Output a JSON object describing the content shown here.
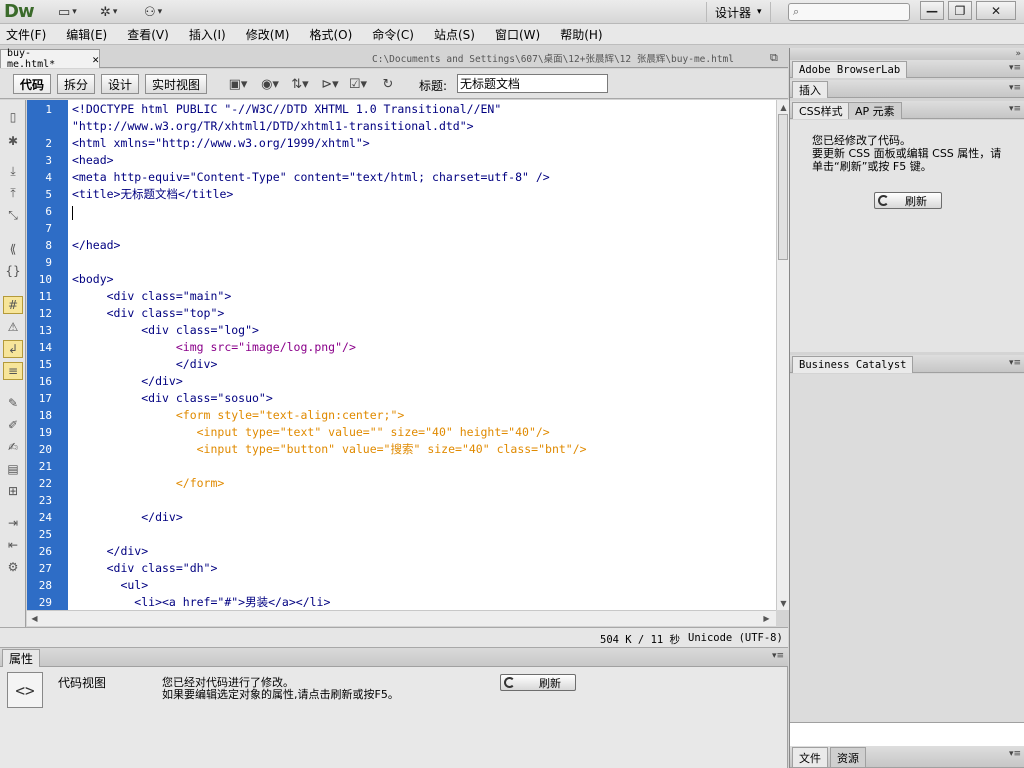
{
  "app": {
    "logo": "Dw",
    "workspace": "设计器",
    "icons": [
      "layout-icon",
      "gear-icon",
      "site-icon"
    ]
  },
  "menu": [
    "文件(F)",
    "编辑(E)",
    "查看(V)",
    "插入(I)",
    "修改(M)",
    "格式(O)",
    "命令(C)",
    "站点(S)",
    "窗口(W)",
    "帮助(H)"
  ],
  "document": {
    "tab_name": "buy-me.html*",
    "path": "C:\\Documents and Settings\\607\\桌面\\12+张晨辉\\12 张晨辉\\buy-me.html"
  },
  "doc_toolbar": {
    "code": "代码",
    "split": "拆分",
    "design": "设计",
    "live": "实时视图",
    "title_label": "标题:",
    "title_value": "无标题文档"
  },
  "line_numbers": [
    "1",
    "",
    "2",
    "3",
    "4",
    "5",
    "6",
    "7",
    "8",
    "9",
    "10",
    "11",
    "12",
    "13",
    "14",
    "15",
    "16",
    "17",
    "18",
    "19",
    "20",
    "21",
    "22",
    "23",
    "24",
    "25",
    "26",
    "27",
    "28",
    "29"
  ],
  "code": [
    {
      "t": "<!DOCTYPE html PUBLIC \"-//W3C//DTD XHTML 1.0 Transitional//EN\"",
      "c": "tag"
    },
    {
      "t": "\"http://www.w3.org/TR/xhtml1/DTD/xhtml1-transitional.dtd\">",
      "c": "tag"
    },
    {
      "t": "<html xmlns=\"http://www.w3.org/1999/xhtml\">",
      "c": "tag"
    },
    {
      "t": "<head>",
      "c": "tag"
    },
    {
      "t": "<meta http-equiv=\"Content-Type\" content=\"text/html; charset=utf-8\" />",
      "c": "tag"
    },
    {
      "t": "<title>无标题文档</title>",
      "c": "tag"
    },
    {
      "t": "",
      "c": "tag"
    },
    {
      "t": "",
      "c": "tag"
    },
    {
      "t": "</head>",
      "c": "tag"
    },
    {
      "t": "",
      "c": "tag"
    },
    {
      "t": "<body>",
      "c": "tag"
    },
    {
      "t": "     <div class=\"main\">",
      "c": "tag"
    },
    {
      "t": "     <div class=\"top\">",
      "c": "tag"
    },
    {
      "t": "          <div class=\"log\">",
      "c": "tag"
    },
    {
      "t": "               <img src=\"image/log.png\"/>",
      "c": "img"
    },
    {
      "t": "               </div>",
      "c": "tag"
    },
    {
      "t": "          </div>",
      "c": "tag"
    },
    {
      "t": "          <div class=\"sosuo\">",
      "c": "tag"
    },
    {
      "t": "               <form style=\"text-align:center;\">",
      "c": "form"
    },
    {
      "t": "                  <input type=\"text\" value=\"\" size=\"40\" height=\"40\"/>",
      "c": "form"
    },
    {
      "t": "                  <input type=\"button\" value=\"搜索\" size=\"40\" class=\"bnt\"/>",
      "c": "form"
    },
    {
      "t": "",
      "c": "tag"
    },
    {
      "t": "               </form>",
      "c": "form"
    },
    {
      "t": "",
      "c": "tag"
    },
    {
      "t": "          </div>",
      "c": "tag"
    },
    {
      "t": "",
      "c": "tag"
    },
    {
      "t": "     </div>",
      "c": "tag"
    },
    {
      "t": "     <div class=\"dh\">",
      "c": "tag"
    },
    {
      "t": "       <ul>",
      "c": "tag"
    },
    {
      "t": "         <li><a href=\"#\">男装</a></li>",
      "c": "tag"
    }
  ],
  "status": {
    "size": "504 K / 11 秒",
    "encoding": "Unicode (UTF-8)"
  },
  "properties": {
    "tab": "属性",
    "view": "代码视图",
    "msg1": "您已经对代码进行了修改。",
    "msg2": "如果要编辑选定对象的属性,请点击刷新或按F5。",
    "refresh": "刷新"
  },
  "panels": {
    "browserlab": "Adobe BrowserLab",
    "insert": "插入",
    "css_tab": "CSS样式",
    "ap_tab": "AP 元素",
    "css_msg1": "您已经修改了代码。",
    "css_msg2": "要更新 CSS 面板或编辑 CSS 属性，请单击“刷新”或按 F5 键。",
    "css_refresh": "刷新",
    "business_catalyst": "Business Catalyst",
    "files_tab": "文件",
    "assets_tab": "资源"
  }
}
